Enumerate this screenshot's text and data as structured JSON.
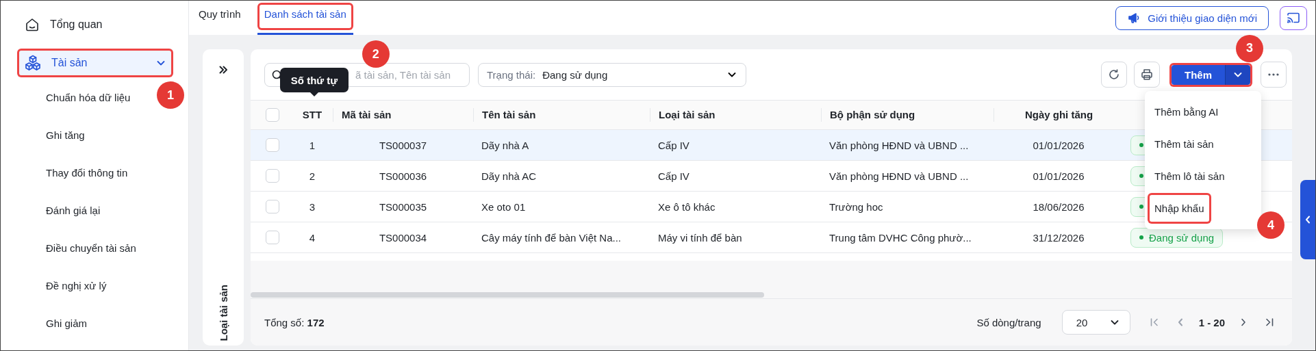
{
  "sidebar": {
    "items": [
      {
        "kind": "link",
        "label": "Tổng quan",
        "selected": false
      },
      {
        "kind": "group",
        "label": "Tài sản",
        "selected": true,
        "expanded": true,
        "highlighted": true,
        "callout": "1",
        "children": [
          {
            "label": "Chuẩn hóa dữ liệu",
            "selected": false
          },
          {
            "label": "Ghi tăng",
            "selected": false
          },
          {
            "label": "Thay đổi thông tin",
            "selected": false
          },
          {
            "label": "Đánh giá lại",
            "selected": false
          },
          {
            "label": "Điều chuyển tài sản",
            "selected": false
          },
          {
            "label": "Đề nghị xử lý",
            "selected": false
          },
          {
            "label": "Ghi giảm",
            "selected": false
          }
        ]
      }
    ]
  },
  "tabs": [
    {
      "label": "Quy trình",
      "selected": false,
      "highlighted": false
    },
    {
      "label": "Danh sách tài sản",
      "selected": true,
      "highlighted": true,
      "callout": "2"
    }
  ],
  "header_buttons": [
    {
      "kind": "announce",
      "label": "Giới thiệu giao diện mới"
    },
    {
      "kind": "cast"
    }
  ],
  "side_panel": {
    "label": "Loại tài sản"
  },
  "toolbar": {
    "search": {
      "placeholder": "ã tài sản, Tên tài sản"
    },
    "status_filter": {
      "label": "Trạng thái:",
      "value": "Đang sử dụng"
    },
    "actions": [
      {
        "kind": "refresh"
      },
      {
        "kind": "print"
      },
      {
        "kind": "split",
        "label": "Thêm",
        "highlighted": true,
        "callout": "3",
        "expanded": true
      },
      {
        "kind": "more"
      }
    ]
  },
  "tooltip": {
    "text": "Số thứ tự"
  },
  "menu": {
    "items": [
      {
        "label": "Thêm bằng AI",
        "highlighted": false
      },
      {
        "label": "Thêm tài sản",
        "highlighted": false
      },
      {
        "label": "Thêm lô tài sản",
        "highlighted": false
      },
      {
        "label": "Nhập khẩu",
        "highlighted": true,
        "callout": "4"
      }
    ]
  },
  "table": {
    "select_all": {
      "checked": false
    },
    "columns": [
      {
        "kind": "center",
        "label": "STT"
      },
      {
        "kind": "text",
        "label": "Mã tài sản"
      },
      {
        "kind": "text",
        "label": "Tên tài sản"
      },
      {
        "kind": "text",
        "label": "Loại tài sản"
      },
      {
        "kind": "text",
        "label": "Bộ phận sử dụng"
      },
      {
        "kind": "center",
        "label": "Ngày ghi tăng"
      }
    ],
    "rows": [
      {
        "checked": false,
        "hovered": true,
        "cells": [
          "1",
          "TS000037",
          "Dãy nhà A",
          "Cấp IV",
          "Văn phòng HĐND và UBND ...",
          "01/01/2026"
        ],
        "status": {}
      },
      {
        "checked": false,
        "hovered": false,
        "cells": [
          "2",
          "TS000036",
          "Dãy nhà AC",
          "Cấp IV",
          "Văn phòng HĐND và UBND ...",
          "01/01/2026"
        ],
        "status": {}
      },
      {
        "checked": false,
        "hovered": false,
        "cells": [
          "3",
          "TS000035",
          "Xe oto 01",
          "Xe ô tô khác",
          "Trường hoc",
          "18/06/2026"
        ],
        "status": {}
      },
      {
        "checked": false,
        "hovered": false,
        "cells": [
          "4",
          "TS000034",
          "Cây máy tính để bàn Việt Na...",
          "Máy vi tính để bàn",
          "Trung tâm DVHC Công phườ...",
          "31/12/2026"
        ],
        "status": {
          "text": "Đang sử dụng"
        }
      }
    ]
  },
  "footer": {
    "total_label": "Tổng số:",
    "total": "172",
    "page_size_label": "Số dòng/trang",
    "page_size": "20",
    "range": "1 - 20"
  }
}
